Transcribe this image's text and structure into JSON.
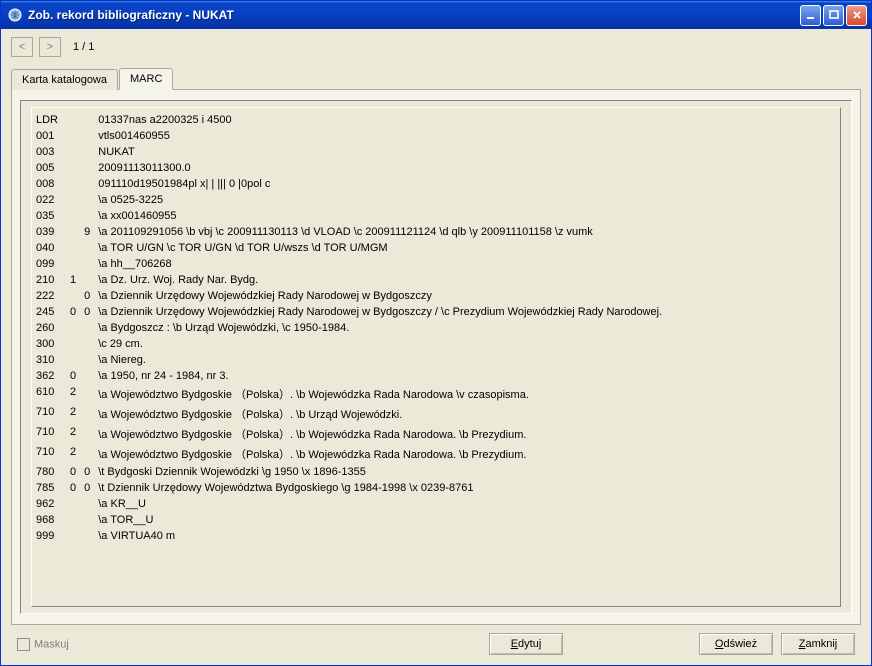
{
  "window": {
    "title": "Zob. rekord bibliograficzny - NUKAT"
  },
  "nav": {
    "prev": "<",
    "next": ">",
    "page": "1 / 1"
  },
  "tabs": {
    "catalog": "Karta katalogowa",
    "marc": "MARC"
  },
  "marc_rows": [
    {
      "tag": "LDR",
      "i1": "",
      "i2": "",
      "val": "01337nas a2200325 i 4500"
    },
    {
      "tag": "001",
      "i1": "",
      "i2": "",
      "val": "vtls001460955"
    },
    {
      "tag": "003",
      "i1": "",
      "i2": "",
      "val": "NUKAT"
    },
    {
      "tag": "005",
      "i1": "",
      "i2": "",
      "val": "20091113011300.0"
    },
    {
      "tag": "008",
      "i1": "",
      "i2": "",
      "val": "091110d19501984pl  x| |  ||| 0   |0pol c"
    },
    {
      "tag": "022",
      "i1": "",
      "i2": "",
      "val": "\\a 0525-3225"
    },
    {
      "tag": "035",
      "i1": "",
      "i2": "",
      "val": "\\a xx001460955"
    },
    {
      "tag": "039",
      "i1": "",
      "i2": "9",
      "val": "\\a 201109291056 \\b vbj \\c 200911130113 \\d VLOAD \\c 200911121124 \\d qlb \\y 200911101158 \\z vumk"
    },
    {
      "tag": "040",
      "i1": "",
      "i2": "",
      "val": "\\a TOR U/GN \\c TOR U/GN \\d TOR U/wszs \\d TOR U/MGM"
    },
    {
      "tag": "099",
      "i1": "",
      "i2": "",
      "val": "\\a hh__706268"
    },
    {
      "tag": "210",
      "i1": "1",
      "i2": "",
      "val": "\\a Dz. Urz. Woj. Rady Nar. Bydg."
    },
    {
      "tag": "222",
      "i1": "",
      "i2": "0",
      "val": "\\a Dziennik Urzędowy Wojewódzkiej Rady Narodowej w Bydgoszczy"
    },
    {
      "tag": "245",
      "i1": "0",
      "i2": "0",
      "val": "\\a Dziennik Urzędowy Wojewódzkiej Rady Narodowej w Bydgoszczy / \\c Prezydium Wojewódzkiej Rady Narodowej."
    },
    {
      "tag": "260",
      "i1": "",
      "i2": "",
      "val": "\\a Bydgoszcz : \\b Urząd Wojewódzki, \\c 1950-1984."
    },
    {
      "tag": "300",
      "i1": "",
      "i2": "",
      "val": "\\c 29 cm."
    },
    {
      "tag": "310",
      "i1": "",
      "i2": "",
      "val": "\\a Niereg."
    },
    {
      "tag": "362",
      "i1": "0",
      "i2": "",
      "val": "\\a 1950, nr 24 - 1984, nr 3."
    },
    {
      "tag": "610",
      "i1": "2",
      "i2": "",
      "val": "\\a Województwo Bydgoskie （Polska）. \\b Wojewódzka Rada Narodowa \\v czasopisma."
    },
    {
      "tag": "710",
      "i1": "2",
      "i2": "",
      "val": "\\a Województwo Bydgoskie （Polska）. \\b Urząd Wojewódzki."
    },
    {
      "tag": "710",
      "i1": "2",
      "i2": "",
      "val": "\\a Województwo Bydgoskie （Polska）. \\b Wojewódzka Rada Narodowa. \\b Prezydium."
    },
    {
      "tag": "710",
      "i1": "2",
      "i2": "",
      "val": "\\a Województwo Bydgoskie （Polska）. \\b Wojewódzka Rada Narodowa. \\b Prezydium."
    },
    {
      "tag": "780",
      "i1": "0",
      "i2": "0",
      "val": "\\t Bydgoski Dziennik Wojewódzki \\g 1950 \\x 1896-1355"
    },
    {
      "tag": "785",
      "i1": "0",
      "i2": "0",
      "val": "\\t Dziennik Urzędowy Województwa Bydgoskiego \\g 1984-1998 \\x 0239-8761"
    },
    {
      "tag": "962",
      "i1": "",
      "i2": "",
      "val": "\\a KR__U"
    },
    {
      "tag": "968",
      "i1": "",
      "i2": "",
      "val": "\\a TOR__U"
    },
    {
      "tag": "999",
      "i1": "",
      "i2": "",
      "val": "\\a VIRTUA40          m"
    }
  ],
  "footer": {
    "mask": "Maskuj",
    "edit": "Edytuj",
    "refresh": "Odśwież",
    "close": "Zamknij"
  }
}
